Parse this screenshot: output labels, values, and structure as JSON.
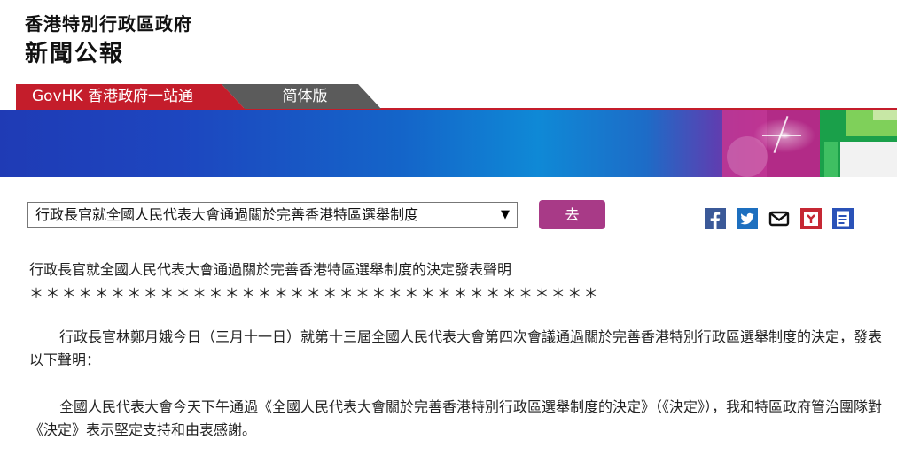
{
  "header": {
    "gov_name": "香港特別行政區政府",
    "title": "新聞公報"
  },
  "nav": {
    "govhk_tab": "GovHK 香港政府一站通",
    "simplified_tab": "简体版"
  },
  "toolbar": {
    "select_value": "行政長官就全國人民代表大會通過關於完善香港特區選舉制度",
    "go_label": "去",
    "share_icons": [
      "facebook-icon",
      "twitter-icon",
      "email-icon",
      "bookmark-icon",
      "print-icon"
    ]
  },
  "article": {
    "headline": "行政長官就全國人民代表大會通過關於完善香港特區選舉制度的決定發表聲明",
    "separator": "＊＊＊＊＊＊＊＊＊＊＊＊＊＊＊＊＊＊＊＊＊＊＊＊＊＊＊＊＊＊＊＊＊＊＊",
    "paragraphs": [
      "行政長官林鄭月娥今日（三月十一日）就第十三屆全國人民代表大會第四次會議通過關於完善香港特別行政區選舉制度的決定，發表以下聲明：",
      "全國人民代表大會今天下午通過《全國人民代表大會關於完善香港特別行政區選舉制度的決定》（《決定》），我和特區政府管治團隊對《決定》表示堅定支持和由衷感謝。"
    ]
  },
  "colors": {
    "accent_red": "#c41d2b",
    "tab_gray": "#5b5b5b",
    "go_button": "#a83a87"
  }
}
